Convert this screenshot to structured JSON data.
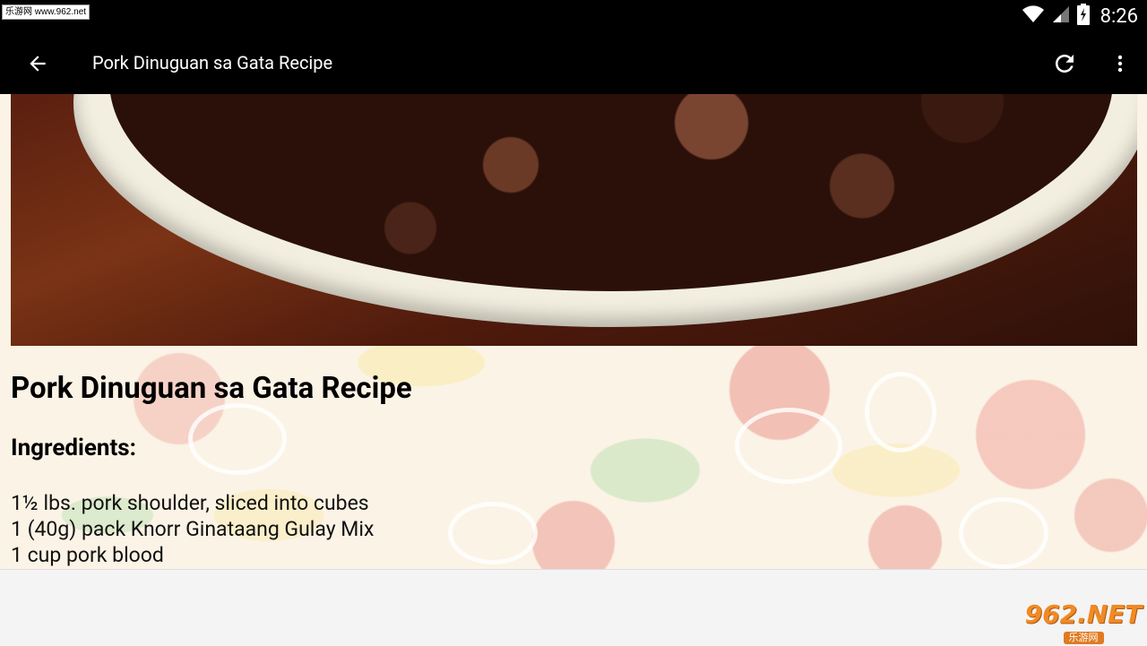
{
  "status_bar": {
    "watermark": "乐游网 www.962.net",
    "time": "8:26"
  },
  "app_bar": {
    "title": "Pork Dinuguan sa Gata Recipe",
    "back_icon": "arrow-back-icon",
    "refresh_icon": "refresh-icon",
    "more_icon": "more-vert-icon"
  },
  "recipe": {
    "title": "Pork Dinuguan sa Gata Recipe",
    "ingredients_heading": "Ingredients:",
    "ingredients": [
      "1½ lbs. pork shoulder, sliced into cubes",
      "1 (40g) pack Knorr Ginataang Gulay Mix",
      "1 cup pork blood"
    ]
  },
  "watermark_logo": {
    "main": "962.NET",
    "sub": "乐游网"
  }
}
